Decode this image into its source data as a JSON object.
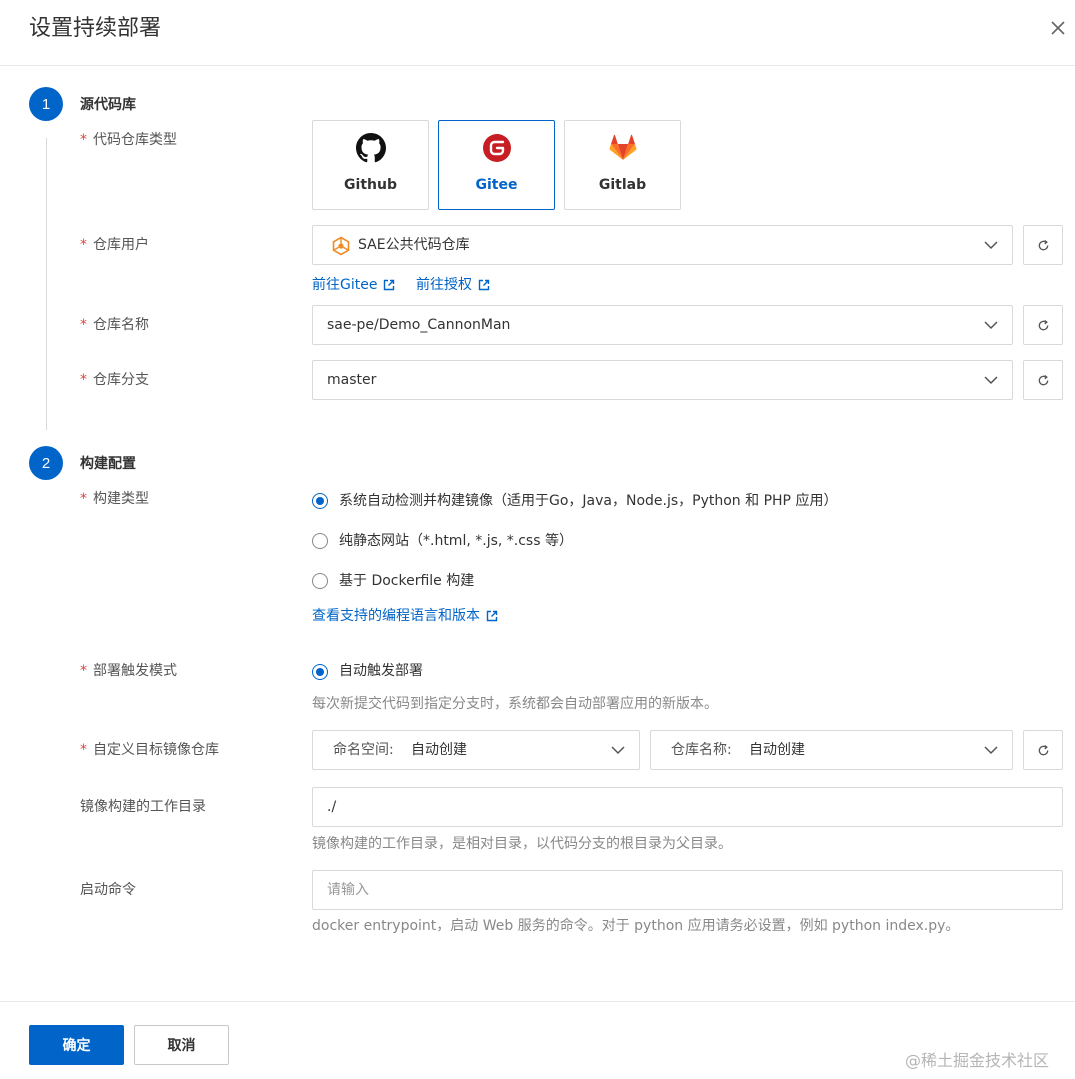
{
  "dialog": {
    "title": "设置持续部署",
    "close_icon": "close-icon"
  },
  "step1": {
    "number": "1",
    "title": "源代码库",
    "repo_type_label": "代码仓库类型",
    "repo_types": [
      {
        "name": "Github",
        "icon": "github-icon",
        "selected": false
      },
      {
        "name": "Gitee",
        "icon": "gitee-icon",
        "selected": true
      },
      {
        "name": "Gitlab",
        "icon": "gitlab-icon",
        "selected": false
      }
    ],
    "repo_user_label": "仓库用户",
    "repo_user_value": "SAE公共代码仓库",
    "link_goto_gitee": "前往Gitee",
    "link_authorize": "前往授权",
    "repo_name_label": "仓库名称",
    "repo_name_value": "sae-pe/Demo_CannonMan",
    "repo_branch_label": "仓库分支",
    "repo_branch_value": "master"
  },
  "step2": {
    "number": "2",
    "title": "构建配置",
    "build_type_label": "构建类型",
    "build_options": [
      {
        "label": "系统自动检测并构建镜像（适用于Go，Java，Node.js，Python 和 PHP 应用）",
        "selected": true
      },
      {
        "label": "纯静态网站（*.html, *.js, *.css 等）",
        "selected": false
      },
      {
        "label": "基于 Dockerfile 构建",
        "selected": false
      }
    ],
    "link_supported_langs": "查看支持的编程语言和版本",
    "trigger_label": "部署触发模式",
    "trigger_option": "自动触发部署",
    "trigger_help": "每次新提交代码到指定分支时，系统都会自动部署应用的新版本。",
    "target_repo_label": "自定义目标镜像仓库",
    "namespace_prefix": "命名空间:",
    "namespace_value": "自动创建",
    "repo_prefix": "仓库名称:",
    "repo_value": "自动创建",
    "workdir_label": "镜像构建的工作目录",
    "workdir_value": "./",
    "workdir_help": "镜像构建的工作目录，是相对目录，以代码分支的根目录为父目录。",
    "start_cmd_label": "启动命令",
    "start_cmd_placeholder": "请输入",
    "start_cmd_help": "docker entrypoint，启动 Web 服务的命令。对于 python 应用请务必设置，例如 python index.py。"
  },
  "footer": {
    "confirm": "确定",
    "cancel": "取消",
    "watermark": "@稀土掘金技术社区"
  },
  "colors": {
    "primary": "#0064c8",
    "required": "#e0423d",
    "gitee": "#c71d23",
    "gitlab": "#e24329"
  }
}
